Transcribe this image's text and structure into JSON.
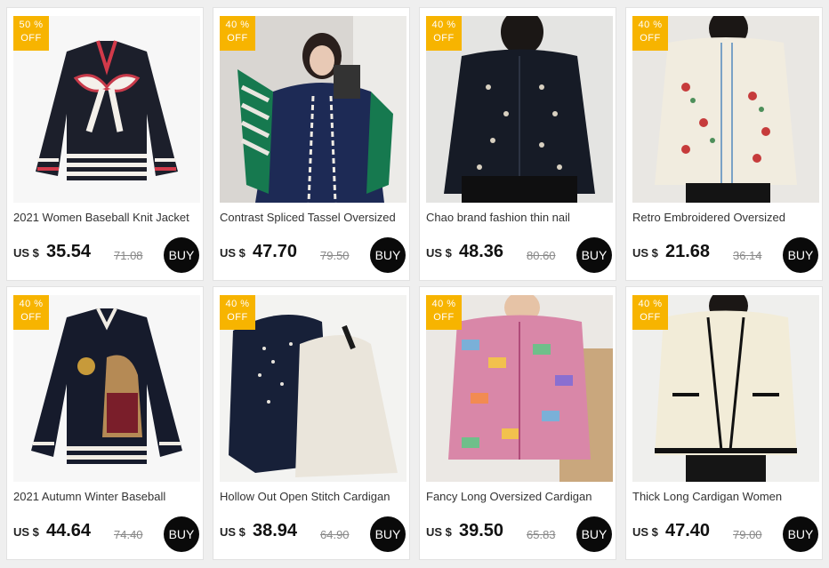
{
  "currency_label": "US $",
  "buy_label": "BUY",
  "products": [
    {
      "badge_pct": "50 %",
      "badge_off": "OFF",
      "title": "2021 Women Baseball Knit Jacket",
      "price": "35.54",
      "old_price": "71.08"
    },
    {
      "badge_pct": "40 %",
      "badge_off": "OFF",
      "title": "Contrast Spliced Tassel Oversized",
      "price": "47.70",
      "old_price": "79.50"
    },
    {
      "badge_pct": "40 %",
      "badge_off": "OFF",
      "title": "Chao brand fashion thin nail",
      "price": "48.36",
      "old_price": "80.60"
    },
    {
      "badge_pct": "40 %",
      "badge_off": "OFF",
      "title": "Retro Embroidered Oversized",
      "price": "21.68",
      "old_price": "36.14"
    },
    {
      "badge_pct": "40 %",
      "badge_off": "OFF",
      "title": "2021 Autumn Winter Baseball",
      "price": "44.64",
      "old_price": "74.40"
    },
    {
      "badge_pct": "40 %",
      "badge_off": "OFF",
      "title": "Hollow Out Open Stitch Cardigan",
      "price": "38.94",
      "old_price": "64.90"
    },
    {
      "badge_pct": "40 %",
      "badge_off": "OFF",
      "title": "Fancy Long Oversized Cardigan",
      "price": "39.50",
      "old_price": "65.83"
    },
    {
      "badge_pct": "40 %",
      "badge_off": "OFF",
      "title": "Thick Long Cardigan Women",
      "price": "47.40",
      "old_price": "79.00"
    }
  ]
}
